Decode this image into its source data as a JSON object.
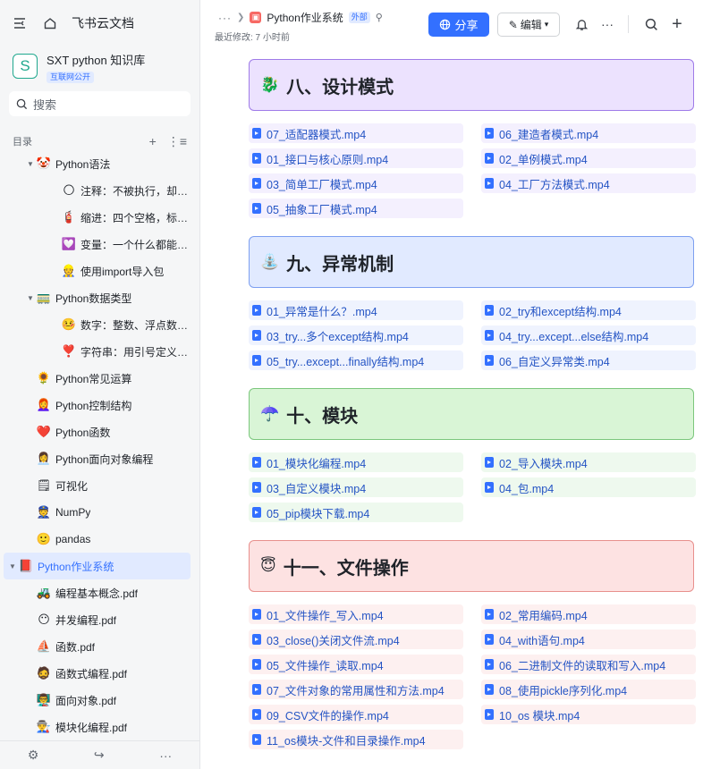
{
  "sidebar": {
    "brand": "飞书云文档",
    "kb_logo": "S",
    "kb_title": "SXT python 知识库",
    "kb_badge": "互联网公开",
    "search_placeholder": "搜索",
    "toc_label": "目录",
    "items": [
      {
        "indent": 1,
        "arrow": "▼",
        "emoji": "🤡",
        "label": "Python语法"
      },
      {
        "indent": 2,
        "arrow": "",
        "emoji": "🌕",
        "label": "注释：不被执行，却很..."
      },
      {
        "indent": 2,
        "arrow": "",
        "emoji": "🧯",
        "label": "缩进：四个空格，标识..."
      },
      {
        "indent": 2,
        "arrow": "",
        "emoji": "💟",
        "label": "变量：一个什么都能装..."
      },
      {
        "indent": 2,
        "arrow": "",
        "emoji": "👷",
        "label": "使用import导入包"
      },
      {
        "indent": 1,
        "arrow": "▼",
        "emoji": "🚃",
        "label": "Python数据类型"
      },
      {
        "indent": 2,
        "arrow": "",
        "emoji": "🤒",
        "label": "数字：整数、浮点数、..."
      },
      {
        "indent": 2,
        "arrow": "",
        "emoji": "❣️",
        "label": "字符串：用引号定义的..."
      },
      {
        "indent": 1,
        "arrow": "",
        "emoji": "🌻",
        "label": "Python常见运算"
      },
      {
        "indent": 1,
        "arrow": "",
        "emoji": "👩‍🦰",
        "label": "Python控制结构"
      },
      {
        "indent": 1,
        "arrow": "",
        "emoji": "❤️",
        "label": "Python函数"
      },
      {
        "indent": 1,
        "arrow": "",
        "emoji": "👩‍💼",
        "label": "Python面向对象编程"
      },
      {
        "indent": 1,
        "arrow": "",
        "emoji": "🗒",
        "label": "可视化"
      },
      {
        "indent": 1,
        "arrow": "",
        "emoji": "👮",
        "label": "NumPy"
      },
      {
        "indent": 1,
        "arrow": "",
        "emoji": "🙂",
        "label": "pandas"
      },
      {
        "indent": 0,
        "arrow": "▼",
        "emoji": "📕",
        "label": "Python作业系统",
        "selected": true
      },
      {
        "indent": 1,
        "arrow": "",
        "emoji": "🚜",
        "label": "编程基本概念.pdf"
      },
      {
        "indent": 1,
        "arrow": "",
        "emoji": "😶",
        "label": "并发编程.pdf"
      },
      {
        "indent": 1,
        "arrow": "",
        "emoji": "⛵",
        "label": "函数.pdf"
      },
      {
        "indent": 1,
        "arrow": "",
        "emoji": "🧔",
        "label": "函数式编程.pdf"
      },
      {
        "indent": 1,
        "arrow": "",
        "emoji": "👨‍🏫",
        "label": "面向对象.pdf"
      },
      {
        "indent": 1,
        "arrow": "",
        "emoji": "👨‍🏭",
        "label": "模块化编程.pdf"
      }
    ],
    "footer_icons": [
      "settings-icon",
      "share-icon",
      "more-icon"
    ]
  },
  "header": {
    "breadcrumb_more": "···",
    "doc_title": "Python作业系统",
    "doc_badge": "外部",
    "modified": "最近修改: 7 小时前",
    "share_label": "分享",
    "edit_label": "编辑"
  },
  "sections": [
    {
      "title": "八、设计模式",
      "icon": "🐉",
      "theme": "purple",
      "files": [
        "07_适配器模式.mp4",
        "06_建造者模式.mp4",
        "01_接口与核心原则.mp4",
        "02_单例模式.mp4",
        "03_简单工厂模式.mp4",
        "04_工厂方法模式.mp4",
        "05_抽象工厂模式.mp4"
      ]
    },
    {
      "title": "九、异常机制",
      "icon": "⛲",
      "theme": "blue",
      "files": [
        "01_异常是什么？.mp4",
        "02_try和except结构.mp4",
        "03_try...多个except结构.mp4",
        "04_try...except...else结构.mp4",
        "05_try...except...finally结构.mp4",
        "06_自定义异常类.mp4"
      ]
    },
    {
      "title": "十、模块",
      "icon": "☂️",
      "theme": "green",
      "files": [
        "01_模块化编程.mp4",
        "02_导入模块.mp4",
        "03_自定义模块.mp4",
        "04_包.mp4",
        "05_pip模块下载.mp4"
      ]
    },
    {
      "title": "十一、文件操作",
      "icon": "😇",
      "theme": "red",
      "files": [
        "01_文件操作_写入.mp4",
        "02_常用编码.mp4",
        "03_close()关闭文件流.mp4",
        "04_with语句.mp4",
        "05_文件操作_读取.mp4",
        "06_二进制文件的读取和写入.mp4",
        "07_文件对象的常用属性和方法.mp4",
        "08_使用pickle序列化.mp4",
        "09_CSV文件的操作.mp4",
        "10_os 模块.mp4",
        "11_os模块-文件和目录操作.mp4"
      ]
    }
  ]
}
